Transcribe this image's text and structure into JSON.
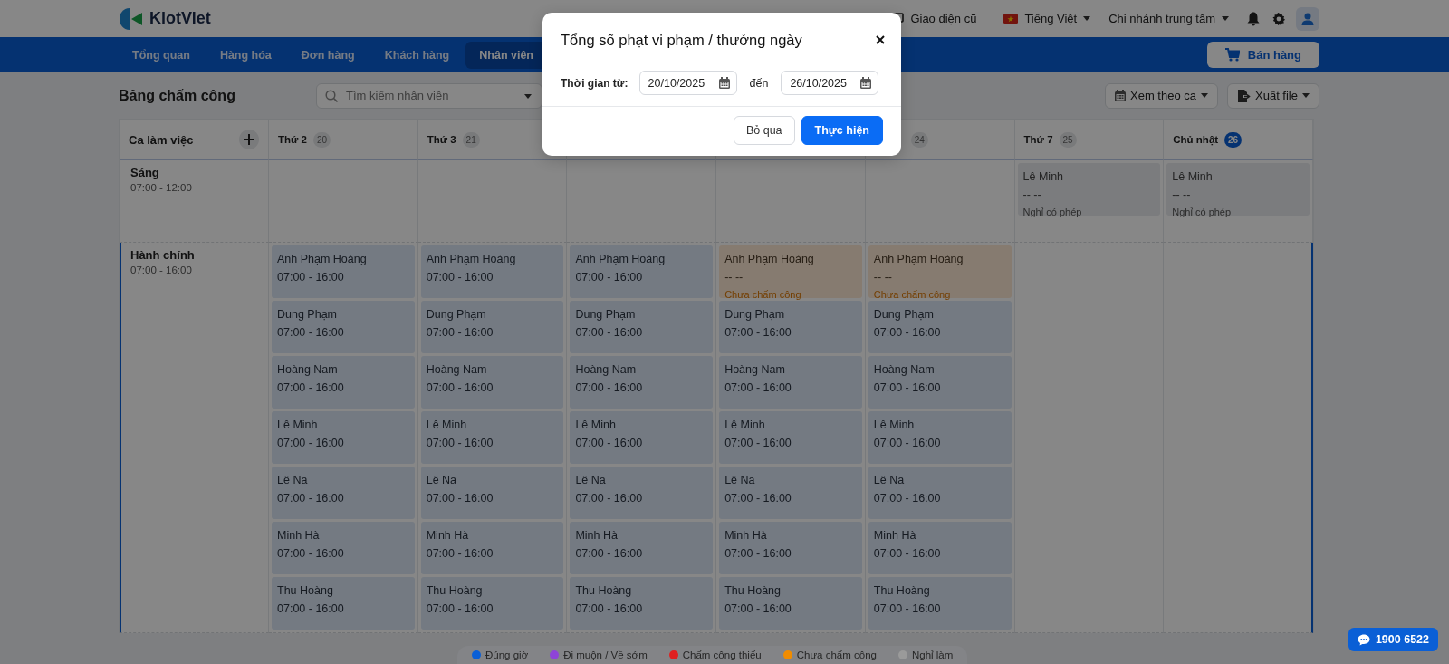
{
  "header": {
    "logo": "KiotViet",
    "old_ui": "Giao diện cũ",
    "language": "Tiếng Việt",
    "branch": "Chi nhánh trung tâm"
  },
  "nav": {
    "tabs": [
      {
        "label": "Tổng quan",
        "selected": false
      },
      {
        "label": "Hàng hóa",
        "selected": false
      },
      {
        "label": "Đơn hàng",
        "selected": false
      },
      {
        "label": "Khách hàng",
        "selected": false
      },
      {
        "label": "Nhân viên",
        "selected": true
      }
    ],
    "sell_button": "Bán hàng"
  },
  "toolbar": {
    "title": "Bảng chấm công",
    "search": {
      "placeholder": "Tìm kiếm nhân viên"
    },
    "view_button": "Xem theo ca",
    "export_button": "Xuất file"
  },
  "timesheet": {
    "shift_header": "Ca làm việc",
    "days_left": [
      {
        "label": "Thứ 2",
        "date": "20",
        "today": false
      },
      {
        "label": "Thứ 3",
        "date": "21",
        "today": false
      }
    ],
    "days_right": [
      {
        "date": "24",
        "today": false
      },
      {
        "label": "Thứ 7",
        "date": "25",
        "today": false
      },
      {
        "label": "Chủ nhật",
        "date": "26",
        "today": true
      }
    ],
    "shifts": [
      {
        "name": "Sáng",
        "time": "07:00 - 12:00",
        "selected": false,
        "cells": [
          [],
          [],
          [],
          [],
          [],
          [
            {
              "kind": "leave",
              "name": "Lê Minh",
              "time": "-- --",
              "status": "Nghỉ có phép"
            }
          ],
          [
            {
              "kind": "leave",
              "name": "Lê Minh",
              "time": "-- --",
              "status": "Nghỉ có phép"
            }
          ]
        ]
      },
      {
        "name": "Hành chính",
        "time": "07:00 - 16:00",
        "selected": true,
        "cells": [
          [
            {
              "kind": "normal",
              "name": "Anh Phạm Hoàng",
              "time": "07:00 - 16:00"
            },
            {
              "kind": "normal",
              "name": "Dung Phạm",
              "time": "07:00 - 16:00"
            },
            {
              "kind": "normal",
              "name": "Hoàng Nam",
              "time": "07:00 - 16:00"
            },
            {
              "kind": "normal",
              "name": "Lê Minh",
              "time": "07:00 - 16:00"
            },
            {
              "kind": "normal",
              "name": "Lê Na",
              "time": "07:00 - 16:00"
            },
            {
              "kind": "normal",
              "name": "Minh Hà",
              "time": "07:00 - 16:00"
            },
            {
              "kind": "normal",
              "name": "Thu Hoàng",
              "time": "07:00 - 16:00"
            }
          ],
          [
            {
              "kind": "normal",
              "name": "Anh Phạm Hoàng",
              "time": "07:00 - 16:00"
            },
            {
              "kind": "normal",
              "name": "Dung Phạm",
              "time": "07:00 - 16:00"
            },
            {
              "kind": "normal",
              "name": "Hoàng Nam",
              "time": "07:00 - 16:00"
            },
            {
              "kind": "normal",
              "name": "Lê Minh",
              "time": "07:00 - 16:00"
            },
            {
              "kind": "normal",
              "name": "Lê Na",
              "time": "07:00 - 16:00"
            },
            {
              "kind": "normal",
              "name": "Minh Hà",
              "time": "07:00 - 16:00"
            },
            {
              "kind": "normal",
              "name": "Thu Hoàng",
              "time": "07:00 - 16:00"
            }
          ],
          [
            {
              "kind": "normal",
              "name": "Anh Phạm Hoàng",
              "time": "07:00 - 16:00"
            },
            {
              "kind": "normal",
              "name": "Dung Phạm",
              "time": "07:00 - 16:00"
            },
            {
              "kind": "normal",
              "name": "Hoàng Nam",
              "time": "07:00 - 16:00"
            },
            {
              "kind": "normal",
              "name": "Lê Minh",
              "time": "07:00 - 16:00"
            },
            {
              "kind": "normal",
              "name": "Lê Na",
              "time": "07:00 - 16:00"
            },
            {
              "kind": "normal",
              "name": "Minh Hà",
              "time": "07:00 - 16:00"
            },
            {
              "kind": "normal",
              "name": "Thu Hoàng",
              "time": "07:00 - 16:00"
            }
          ],
          [
            {
              "kind": "pending",
              "name": "Anh Phạm Hoàng",
              "time": "-- --",
              "status": "Chưa chấm công"
            },
            {
              "kind": "normal",
              "name": "Dung Phạm",
              "time": "07:00 - 16:00"
            },
            {
              "kind": "normal",
              "name": "Hoàng Nam",
              "time": "07:00 - 16:00"
            },
            {
              "kind": "normal",
              "name": "Lê Minh",
              "time": "07:00 - 16:00"
            },
            {
              "kind": "normal",
              "name": "Lê Na",
              "time": "07:00 - 16:00"
            },
            {
              "kind": "normal",
              "name": "Minh Hà",
              "time": "07:00 - 16:00"
            },
            {
              "kind": "normal",
              "name": "Thu Hoàng",
              "time": "07:00 - 16:00"
            }
          ],
          [
            {
              "kind": "pending",
              "name": "Anh Phạm Hoàng",
              "time": "-- --",
              "status": "Chưa chấm công"
            },
            {
              "kind": "normal",
              "name": "Dung Phạm",
              "time": "07:00 - 16:00"
            },
            {
              "kind": "normal",
              "name": "Hoàng Nam",
              "time": "07:00 - 16:00"
            },
            {
              "kind": "normal",
              "name": "Lê Minh",
              "time": "07:00 - 16:00"
            },
            {
              "kind": "normal",
              "name": "Lê Na",
              "time": "07:00 - 16:00"
            },
            {
              "kind": "normal",
              "name": "Minh Hà",
              "time": "07:00 - 16:00"
            },
            {
              "kind": "normal",
              "name": "Thu Hoàng",
              "time": "07:00 - 16:00"
            }
          ],
          [],
          []
        ]
      }
    ]
  },
  "legend": [
    {
      "label": "Đúng giờ",
      "color": "#0a5fd6"
    },
    {
      "label": "Đi muộn / Về sớm",
      "color": "#8e44d8"
    },
    {
      "label": "Chấm công thiếu",
      "color": "#e02020"
    },
    {
      "label": "Chưa chấm công",
      "color": "#f08c00"
    },
    {
      "label": "Nghỉ làm",
      "color": "#9a9a9a"
    }
  ],
  "hotline": "1900 6522",
  "modal": {
    "title": "Tổng số phạt vi phạm / thưởng ngày",
    "from_label": "Thời gian từ:",
    "from": "20/10/2025",
    "to_label": "đến",
    "to": "26/10/2025",
    "cancel": "Bỏ qua",
    "confirm": "Thực hiện"
  }
}
